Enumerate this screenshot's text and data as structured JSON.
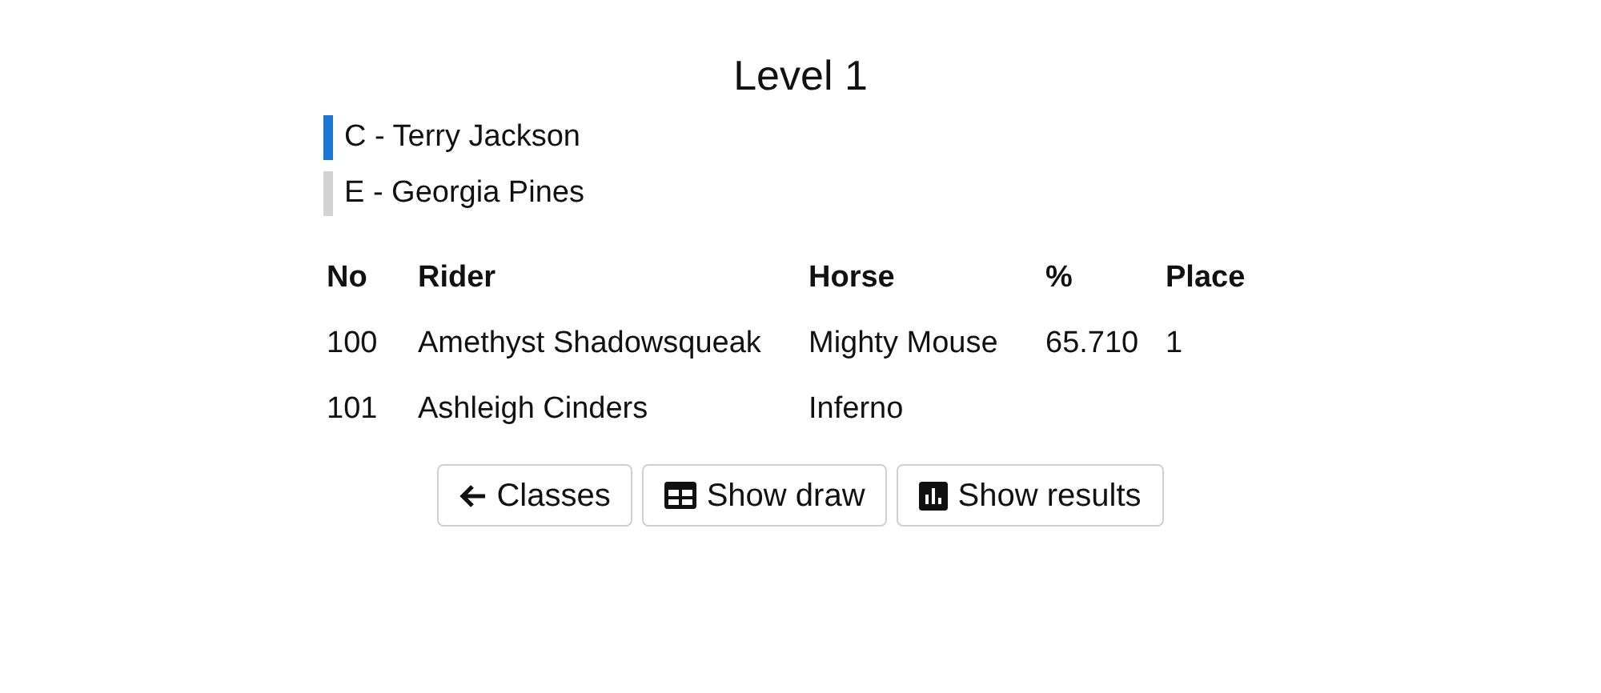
{
  "title": "Level 1",
  "judges": [
    {
      "label": "C - Terry Jackson",
      "color": "#1976d2"
    },
    {
      "label": "E - Georgia Pines",
      "color": "#d3d3d3"
    }
  ],
  "table": {
    "columns": [
      "No",
      "Rider",
      "Horse",
      "%",
      "Place"
    ],
    "rows": [
      [
        "100",
        "Amethyst Shadowsqueak",
        "Mighty Mouse",
        "65.710",
        "1"
      ],
      [
        "101",
        "Ashleigh Cinders",
        "Inferno",
        "",
        ""
      ]
    ]
  },
  "buttons": [
    {
      "kind": "back",
      "label": "Classes"
    },
    {
      "kind": "draw",
      "label": "Show draw"
    },
    {
      "kind": "results",
      "label": "Show results"
    }
  ]
}
